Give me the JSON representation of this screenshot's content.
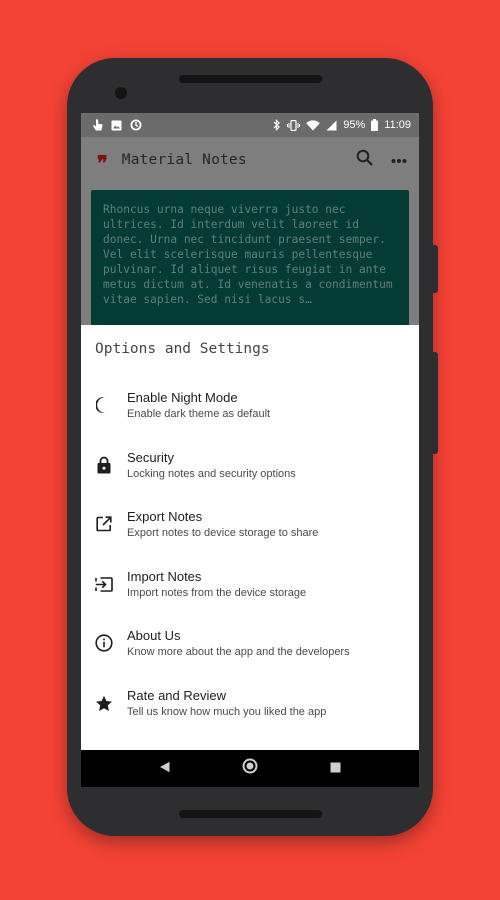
{
  "status_bar": {
    "battery": "95%",
    "time": "11:09"
  },
  "app": {
    "title": "Material Notes",
    "logo_glyph": "❞"
  },
  "note": {
    "text": "Rhoncus urna neque viverra justo nec ultrices. Id interdum velit laoreet id donec. Urna nec tincidunt praesent semper. Vel elit scelerisque mauris pellentesque pulvinar. Id aliquet risus feugiat in ante metus dictum at. Id venenatis a condimentum vitae sapien. Sed nisi lacus s…"
  },
  "sheet": {
    "title": "Options and Settings",
    "options": [
      {
        "icon": "moon-icon",
        "title": "Enable Night Mode",
        "subtitle": "Enable dark theme as default"
      },
      {
        "icon": "lock-icon",
        "title": "Security",
        "subtitle": "Locking notes and security options"
      },
      {
        "icon": "export-icon",
        "title": "Export Notes",
        "subtitle": "Export notes to device storage to share"
      },
      {
        "icon": "import-icon",
        "title": "Import Notes",
        "subtitle": "Import notes from the device storage"
      },
      {
        "icon": "info-icon",
        "title": "About Us",
        "subtitle": "Know more about the app and the developers"
      },
      {
        "icon": "star-icon",
        "title": "Rate and Review",
        "subtitle": "Tell us know how much you liked the app"
      }
    ]
  },
  "colors": {
    "background": "#F44336",
    "note_card": "#053B35",
    "logo_accent": "#7F1018"
  }
}
